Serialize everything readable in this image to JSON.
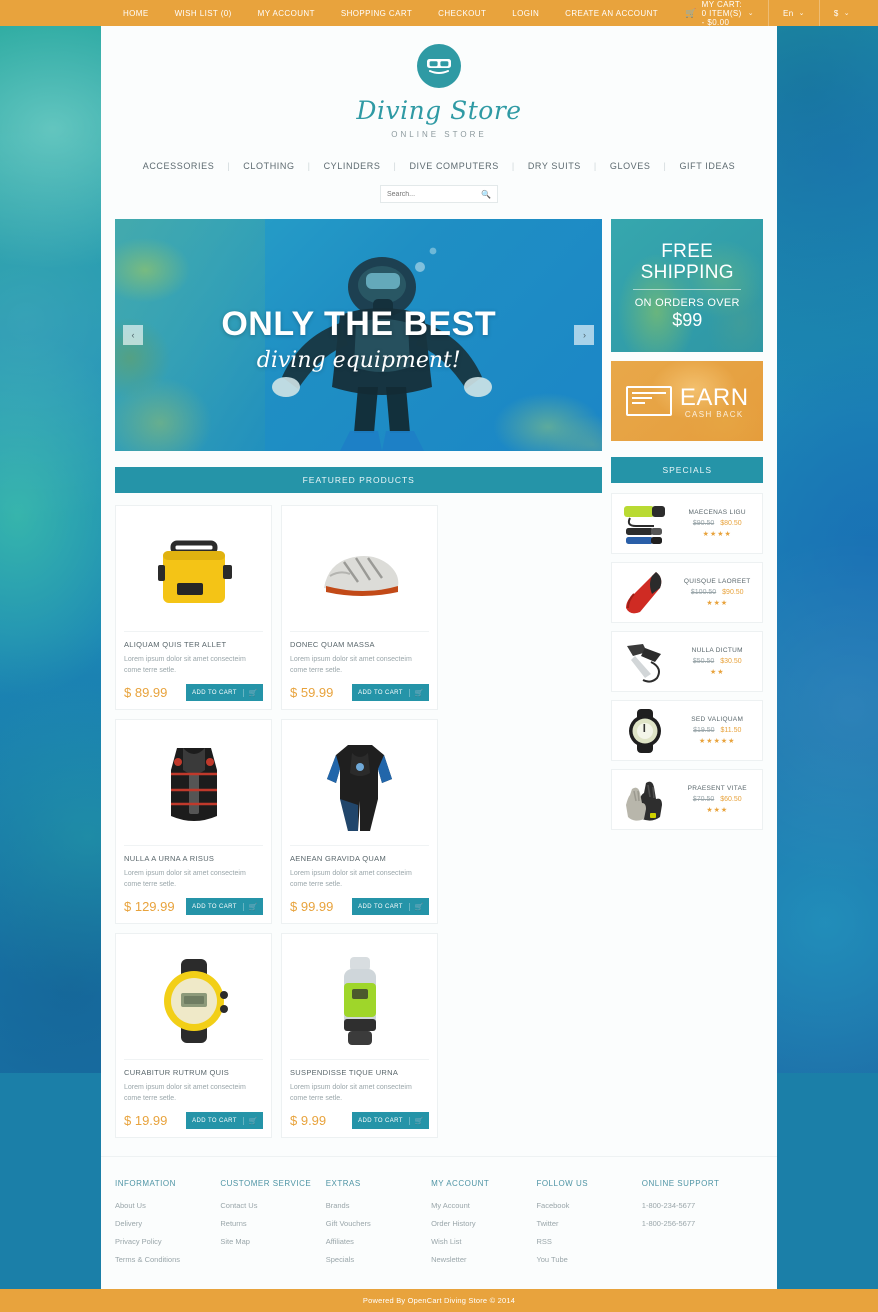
{
  "topbar": {
    "links": [
      "HOME",
      "WISH LIST (0)",
      "MY ACCOUNT",
      "SHOPPING CART",
      "CHECKOUT",
      "LOGIN",
      "CREATE AN ACCOUNT"
    ],
    "cart_label": "MY CART: 0 ITEM(S) - $0.00",
    "cart_icon": "cart-icon",
    "language": "En",
    "currency": "$",
    "caret": "⌄",
    "bg_color": "#e8a33d"
  },
  "logo": {
    "icon": "diving-mask-icon",
    "name": "Diving Store",
    "subtitle": "ONLINE STORE",
    "color": "#2f9aa4"
  },
  "mainnav": {
    "items": [
      "ACCESSORIES",
      "CLOTHING",
      "CYLINDERS",
      "DIVE COMPUTERS",
      "DRY SUITS",
      "GLOVES",
      "GIFT IDEAS"
    ],
    "separator": "|"
  },
  "search": {
    "placeholder": "Search...",
    "value": "",
    "icon": "search-icon"
  },
  "hero": {
    "title": "ONLY THE BEST",
    "subtitle": "diving equipment!",
    "prev_icon": "chevron-left-icon",
    "next_icon": "chevron-right-icon",
    "prev_glyph": "‹",
    "next_glyph": "›"
  },
  "banners": {
    "shipping": {
      "line1": "FREE",
      "line2": "SHIPPING",
      "line3": "ON ORDERS OVER",
      "amount": "$99"
    },
    "cashback": {
      "title": "EARN",
      "subtitle": "CASH BACK",
      "icon": "credit-card-icon"
    }
  },
  "sections": {
    "featured_title": "FEATURED PRODUCTS",
    "specials_title": "SPECIALS"
  },
  "featured": [
    {
      "name": "ALIQUAM QUIS TER ALLET",
      "desc": "Lorem ipsum dolor sit amet consecteim come terre setle.",
      "price": "$ 89.99",
      "button": "ADD TO CART",
      "image": "waterproof-case-yellow"
    },
    {
      "name": "DONEC QUAM MASSA",
      "desc": "Lorem ipsum dolor sit amet consecteim come terre setle.",
      "price": "$ 59.99",
      "button": "ADD TO CART",
      "image": "water-shoe-grey"
    },
    {
      "name": "NULLA A URNA A RISUS",
      "desc": "Lorem ipsum dolor sit amet consecteim come terre setle.",
      "price": "$ 129.99",
      "button": "ADD TO CART",
      "image": "bcd-vest-black"
    },
    {
      "name": "AENEAN GRAVIDA QUAM",
      "desc": "Lorem ipsum dolor sit amet consecteim come terre setle.",
      "price": "$ 99.99",
      "button": "ADD TO CART",
      "image": "wetsuit-black-blue"
    },
    {
      "name": "CURABITUR RUTRUM QUIS",
      "desc": "Lorem ipsum dolor sit amet consecteim come terre setle.",
      "price": "$ 19.99",
      "button": "ADD TO CART",
      "image": "dive-watch-yellow"
    },
    {
      "name": "SUSPENDISSE TIQUE URNA",
      "desc": "Lorem ipsum dolor sit amet consecteim come terre setle.",
      "price": "$ 9.99",
      "button": "ADD TO CART",
      "image": "dive-light-green"
    }
  ],
  "specials": [
    {
      "name": "MAECENAS LIGU",
      "old_price": "$90.50",
      "new_price": "$80.50",
      "stars": 4,
      "image": "dive-torch-green"
    },
    {
      "name": "QUISQUE LAOREET",
      "old_price": "$100.50",
      "new_price": "$90.50",
      "stars": 3,
      "image": "fin-red"
    },
    {
      "name": "NULLA  DICTUM",
      "old_price": "$50.50",
      "new_price": "$30.50",
      "stars": 2,
      "image": "dive-knife-black"
    },
    {
      "name": "SED VALIQUAM",
      "old_price": "$19.50",
      "new_price": "$11.50",
      "stars": 5,
      "image": "dive-watch-black"
    },
    {
      "name": "PRAESENT VITAE",
      "old_price": "$70.50",
      "new_price": "$60.50",
      "stars": 3,
      "image": "dive-gloves-grey"
    }
  ],
  "footer": {
    "columns": [
      {
        "title": "INFORMATION",
        "links": [
          "About Us",
          "Delivery",
          "Privacy Policy",
          "Terms & Conditions"
        ]
      },
      {
        "title": "CUSTOMER SERVICE",
        "links": [
          "Contact Us",
          "Returns",
          "Site Map"
        ]
      },
      {
        "title": "EXTRAS",
        "links": [
          "Brands",
          "Gift Vouchers",
          "Affiliates",
          "Specials"
        ]
      },
      {
        "title": "MY ACCOUNT",
        "links": [
          "My Account",
          "Order History",
          "Wish List",
          "Newsletter"
        ]
      },
      {
        "title": "FOLLOW US",
        "links": [
          "Facebook",
          "Twitter",
          "RSS",
          "You Tube"
        ]
      },
      {
        "title": "ONLINE SUPPORT",
        "links": [
          "1-800-234-5677",
          "1-800-256-5677"
        ]
      }
    ],
    "copyright": "Powered By OpenCart Diving Store © 2014"
  },
  "colors": {
    "accent_teal": "#2594a8",
    "accent_orange": "#e8a33d",
    "logo_teal": "#2f9aa4"
  }
}
